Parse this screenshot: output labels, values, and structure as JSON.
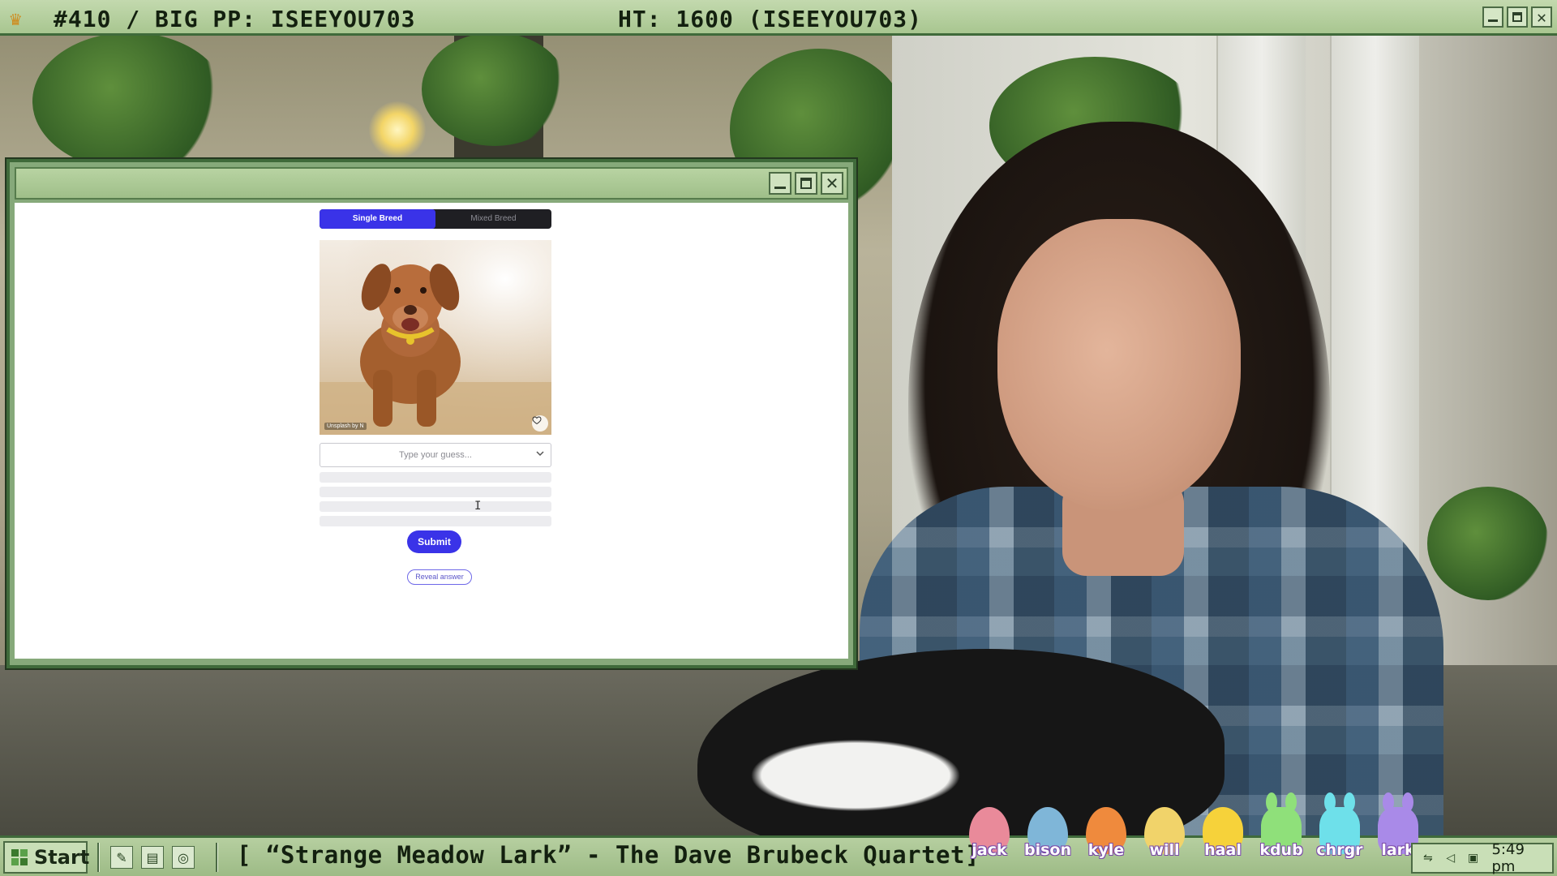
{
  "stream_header": {
    "left_text": "#410 / BIG PP: ISEEYOU703",
    "right_text": "HT: 1600 (ISEEYOU703)"
  },
  "app": {
    "breed_toggle": {
      "options": [
        "Single Breed",
        "Mixed Breed"
      ],
      "selected": "Single Breed"
    },
    "photo": {
      "credit": "Unsplash by N",
      "favorite_icon": "heart-icon"
    },
    "guess": {
      "placeholder": "Type your guess...",
      "value": ""
    },
    "answer_slots_count": 4,
    "submit_label": "Submit",
    "reveal_label": "Reveal answer"
  },
  "taskbar": {
    "start_label": "Start",
    "quick_launch": [
      "notepad-icon",
      "folder-icon",
      "browser-icon"
    ],
    "now_playing": "[ “Strange Meadow Lark” - The Dave Brubeck Quartet]",
    "badges": [
      {
        "name": "jack",
        "kind": "egg",
        "color": "#e98a9a"
      },
      {
        "name": "bison",
        "kind": "egg",
        "color": "#7fb6d8"
      },
      {
        "name": "kyle",
        "kind": "egg",
        "color": "#ef8a3d"
      },
      {
        "name": "will",
        "kind": "egg",
        "color": "#f1d36a"
      },
      {
        "name": "haal",
        "kind": "chick",
        "color": "#f6d23a"
      },
      {
        "name": "kdub",
        "kind": "bunny",
        "color": "#8fe07a"
      },
      {
        "name": "chrgr",
        "kind": "bunny",
        "color": "#6ee0ea"
      },
      {
        "name": "lark",
        "kind": "bunny",
        "color": "#a98ae8"
      }
    ],
    "clock": "5:49 pm"
  },
  "colors": {
    "frame_green": "#3f6a3a",
    "bar_green": "#a8c690",
    "accent_blue": "#3a33e8"
  }
}
